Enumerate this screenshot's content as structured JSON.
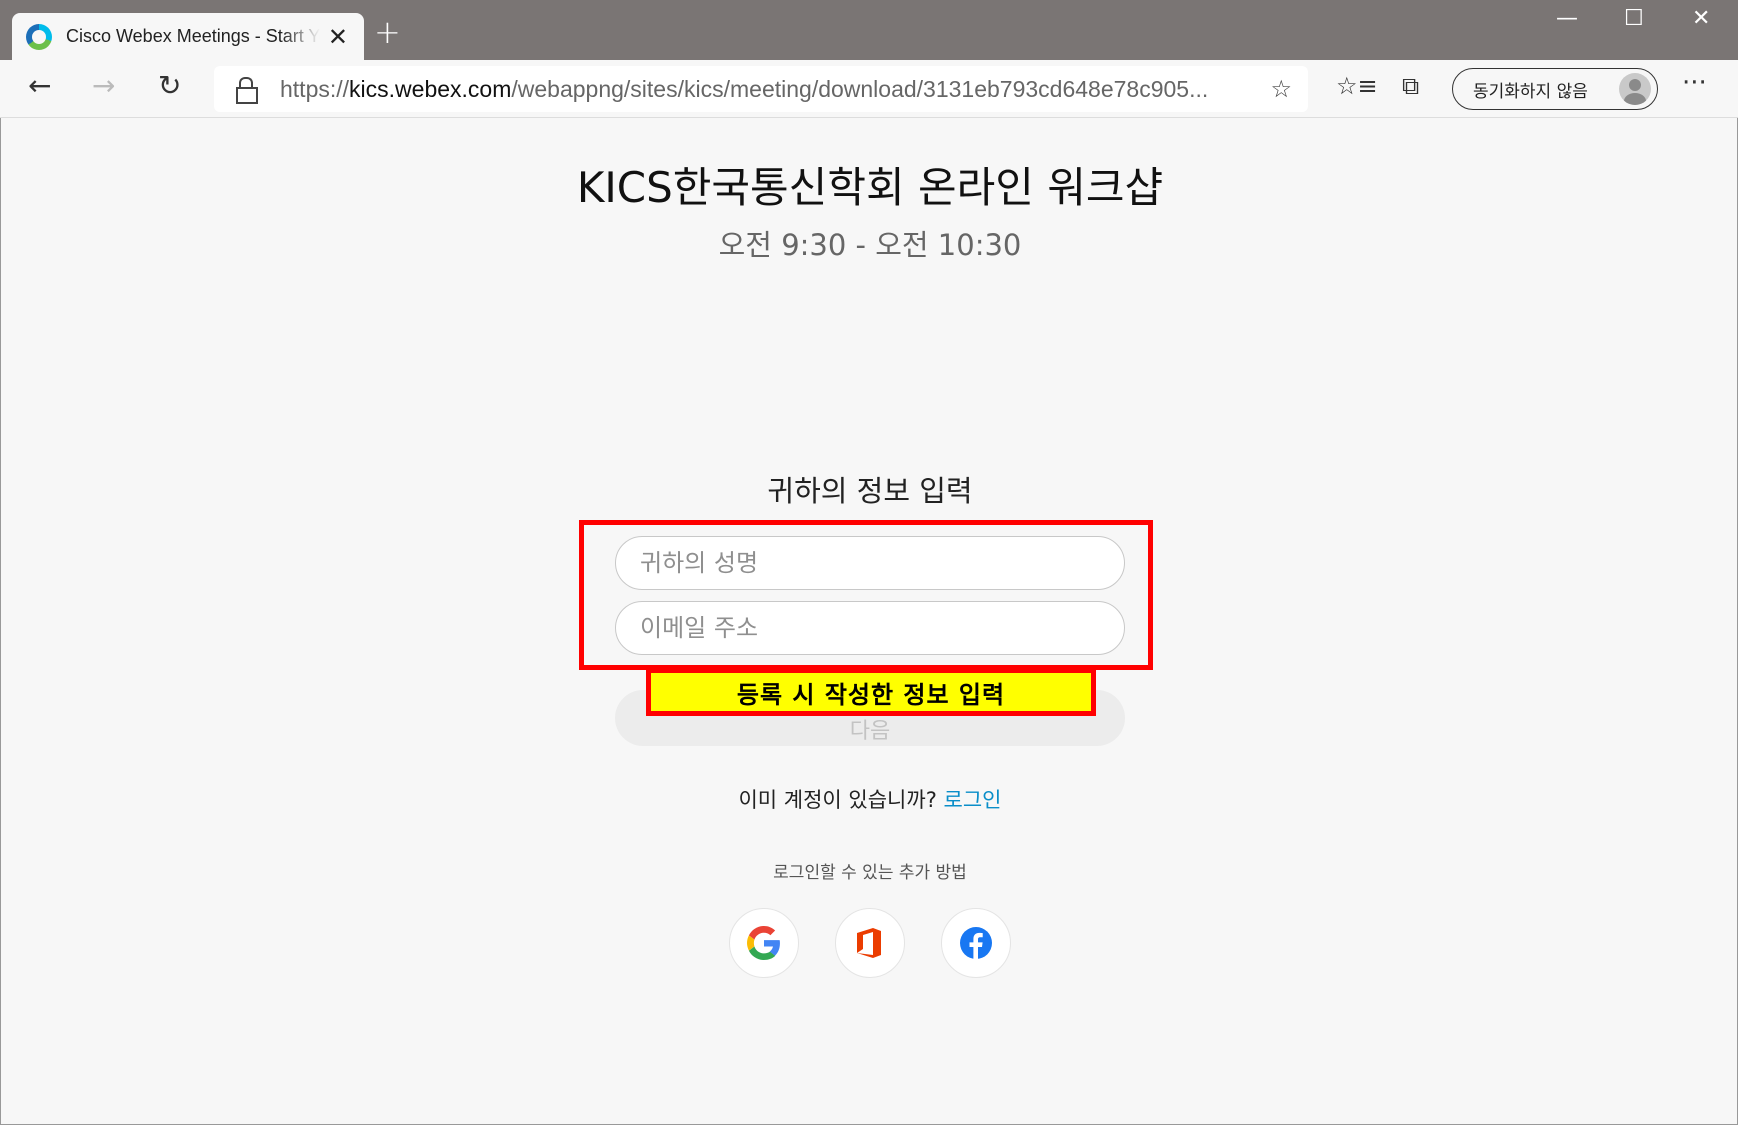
{
  "browser": {
    "tab_title": "Cisco Webex Meetings - Start Your Meeting",
    "new_tab_label": "+",
    "url_prefix": "https://",
    "url_domain": "kics.webex.com",
    "url_path": "/webappng/sites/kics/meeting/download/3131eb793cd648e78c905...",
    "sync_label": "동기화하지 않음",
    "icons": {
      "back": "back-arrow-icon",
      "forward": "forward-arrow-icon",
      "refresh": "refresh-icon",
      "lock": "lock-icon",
      "favorite": "star-icon",
      "favorites_list": "favorites-icon",
      "collections": "collections-icon",
      "more": "more-icon"
    }
  },
  "meeting": {
    "title": "KICS한국통신학회 온라인 워크샵",
    "time": "오전 9:30 - 오전 10:30"
  },
  "form": {
    "heading": "귀하의 정보 입력",
    "name_placeholder": "귀하의 성명",
    "email_placeholder": "이메일 주소",
    "next_label": "다음"
  },
  "annotation": {
    "callout_text": "등록 시 작성한 정보 입력",
    "border_color": "#ff0000",
    "fill_color": "#ffff00"
  },
  "account": {
    "prompt": "이미 계정이 있습니까?",
    "login_label": "로그인",
    "alt_methods_label": "로그인할 수 있는 추가 방법"
  },
  "social_logins": [
    {
      "name": "google-icon"
    },
    {
      "name": "office-icon"
    },
    {
      "name": "facebook-icon"
    }
  ],
  "colors": {
    "link": "#0a8ec9",
    "titlebar": "#7a7574",
    "page_bg": "#f7f7f7"
  }
}
